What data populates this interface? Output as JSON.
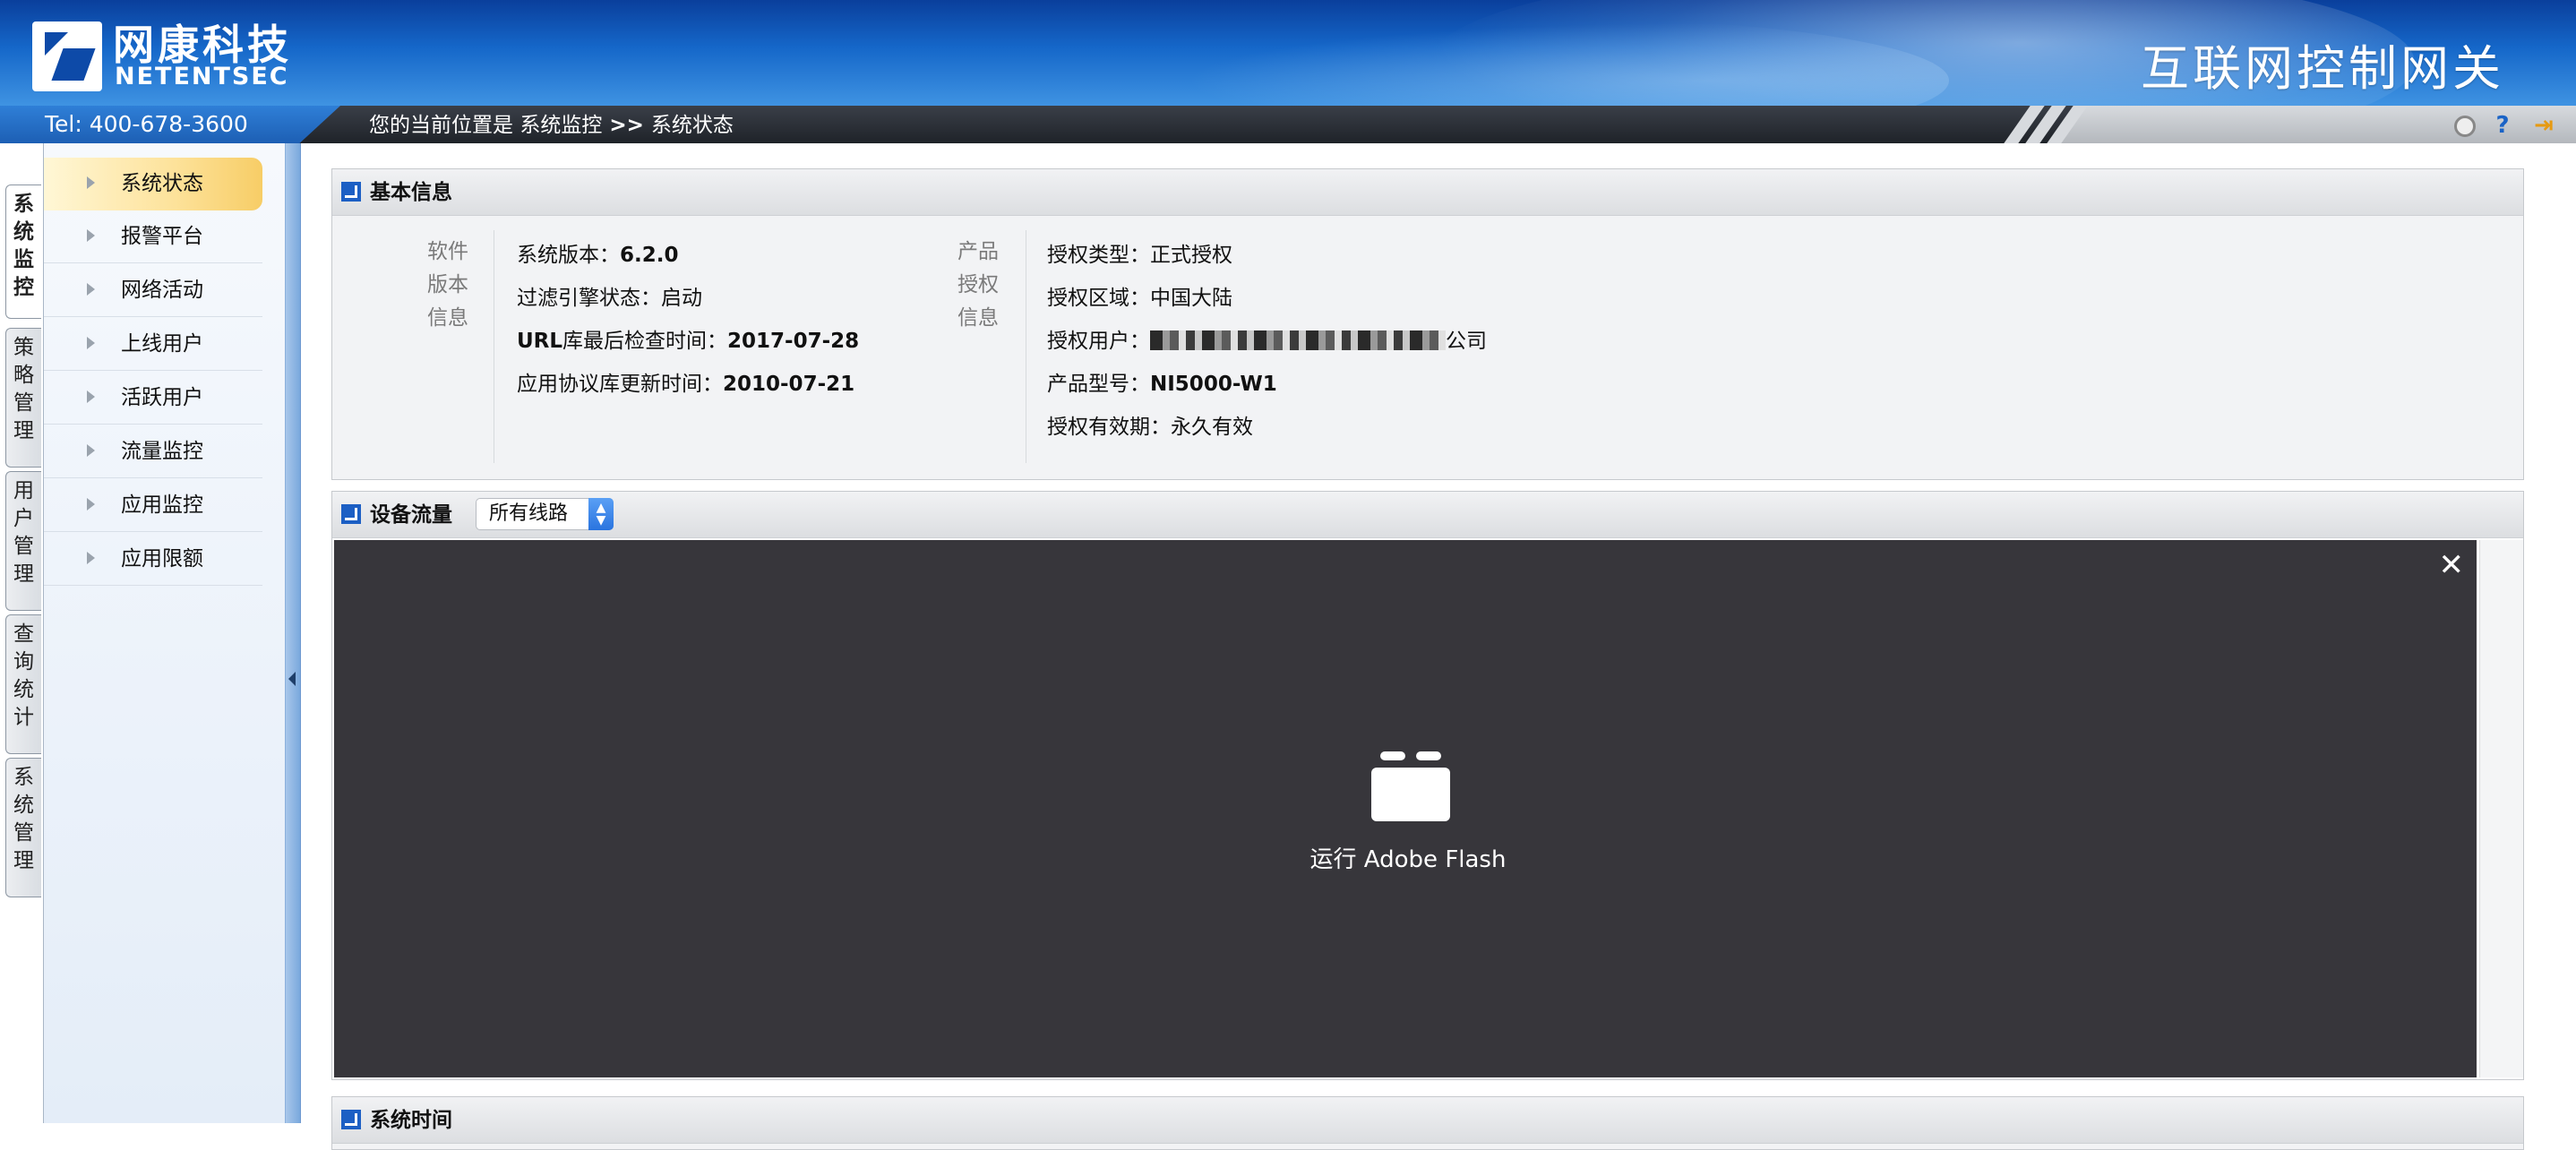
{
  "header": {
    "logo_cn": "网康科技",
    "logo_en": "NETENTSEC",
    "product_name": "互联网控制网关",
    "tel": "Tel: 400-678-3600"
  },
  "breadcrumb": {
    "prefix": "您的当前位置是 ",
    "section": "系统监控",
    "separator": " >> ",
    "page": "系统状态"
  },
  "toolbar_icons": [
    "circle-icon",
    "help-icon",
    "exit-icon"
  ],
  "vertical_tabs": [
    {
      "label": "系统监控",
      "active": true
    },
    {
      "label": "策略管理",
      "active": false
    },
    {
      "label": "用户管理",
      "active": false
    },
    {
      "label": "查询统计",
      "active": false
    },
    {
      "label": "系统管理",
      "active": false
    }
  ],
  "nav_items": [
    {
      "label": "系统状态",
      "active": true
    },
    {
      "label": "报警平台",
      "active": false
    },
    {
      "label": "网络活动",
      "active": false
    },
    {
      "label": "上线用户",
      "active": false
    },
    {
      "label": "活跃用户",
      "active": false
    },
    {
      "label": "流量监控",
      "active": false
    },
    {
      "label": "应用监控",
      "active": false
    },
    {
      "label": "应用限额",
      "active": false
    }
  ],
  "basic_info": {
    "title": "基本信息",
    "software_label": "软件版本信息",
    "software": {
      "version_label": "系统版本：",
      "version": "6.2.0",
      "filter_label": "过滤引擎状态：",
      "filter_state": "启动",
      "url_label_bold": "URL",
      "url_label_rest": "库最后检查时间：",
      "url_date": "2017-07-28",
      "app_label": "应用协议库更新时间：",
      "app_date": "2010-07-21"
    },
    "license_label": "产品授权信息",
    "license": {
      "type_label": "授权类型：",
      "type": "正式授权",
      "region_label": "授权区域：",
      "region": "中国大陆",
      "user_label": "授权用户：",
      "user_suffix": "公司",
      "model_label": "产品型号：",
      "model": "NI5000-W1",
      "validity_label": "授权有效期：",
      "validity": "永久有效"
    }
  },
  "traffic": {
    "title": "设备流量",
    "select_value": "所有线路",
    "flash_label": "运行 Adobe Flash"
  },
  "system_time": {
    "title": "系统时间"
  },
  "colors": {
    "header_blue": "#1567c9",
    "nav_active": "#fde29a",
    "panel_icon": "#1c5fc4"
  }
}
